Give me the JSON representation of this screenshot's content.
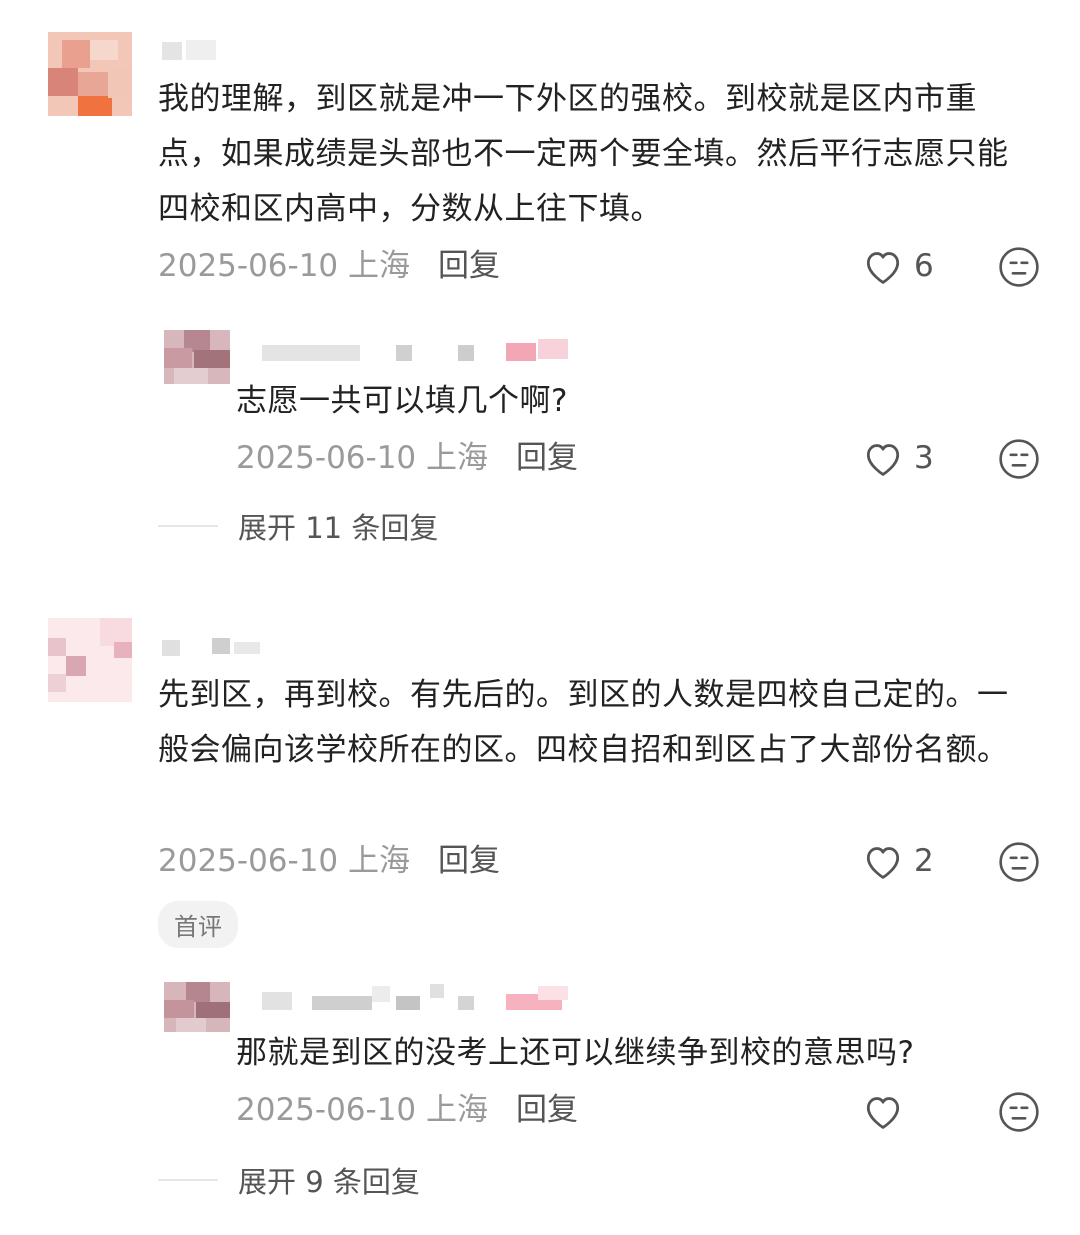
{
  "comments": [
    {
      "text": "我的理解，到区就是冲一下外区的强校。到校就是区内市重点，如果成绩是头部也不一定两个要全填。然后平行志愿只能四校和区内高中，分数从上往下填。",
      "date": "2025-06-10",
      "location": "上海",
      "reply_label": "回复",
      "likes": "6",
      "reply": {
        "text": "志愿一共可以填几个啊?",
        "date": "2025-06-10",
        "location": "上海",
        "reply_label": "回复",
        "likes": "3"
      },
      "expand_label": "展开 11 条回复"
    },
    {
      "text": "先到区，再到校。有先后的。到区的人数是四校自己定的。一般会偏向该学校所在的区。四校自招和到区占了大部份名额。",
      "date": "2025-06-10",
      "location": "上海",
      "reply_label": "回复",
      "likes": "2",
      "badge": "首评",
      "reply": {
        "text": "那就是到区的没考上还可以继续争到校的意思吗?",
        "date": "2025-06-10",
        "location": "上海",
        "reply_label": "回复",
        "likes": ""
      },
      "expand_label": "展开 9 条回复"
    }
  ],
  "colors": {
    "text": "#222222",
    "meta": "#9a9a9a",
    "icon": "#555555"
  }
}
